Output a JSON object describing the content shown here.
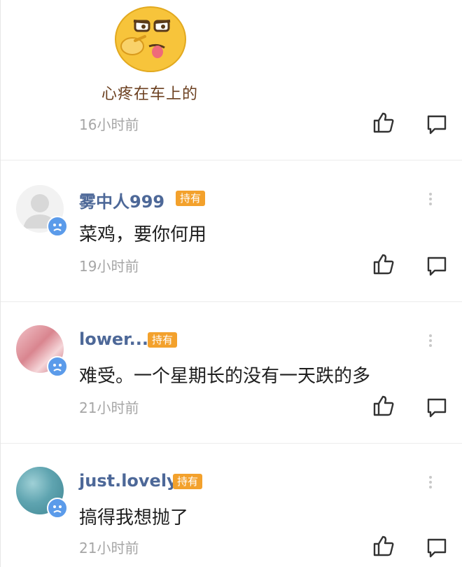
{
  "first_comment": {
    "sticker_caption": "心疼在车上的",
    "time": "16小时前"
  },
  "comments": [
    {
      "username": "雾中人999",
      "tag": "持有",
      "text": "菜鸡，要你何用",
      "time": "19小时前",
      "avatar": "default-avatar"
    },
    {
      "username": "lower...",
      "tag": "持有",
      "text": "难受。一个星期长的没有一天跌的多",
      "time": "21小时前",
      "avatar": "pink-photo-avatar"
    },
    {
      "username": "just.lovely",
      "tag": "持有",
      "text": "搞得我想抛了",
      "time": "21小时前",
      "avatar": "teal-photo-avatar"
    }
  ],
  "icons": {
    "like": "thumbs-up-icon",
    "reply": "comment-bubble-icon",
    "more": "more-vertical-icon",
    "badge": "crying-face-badge-icon"
  },
  "colors": {
    "username": "#4d6898",
    "tag_bg": "#f3a12c",
    "time": "#a6a6a6",
    "text": "#1f1f1f",
    "badge": "#5b9bea"
  }
}
